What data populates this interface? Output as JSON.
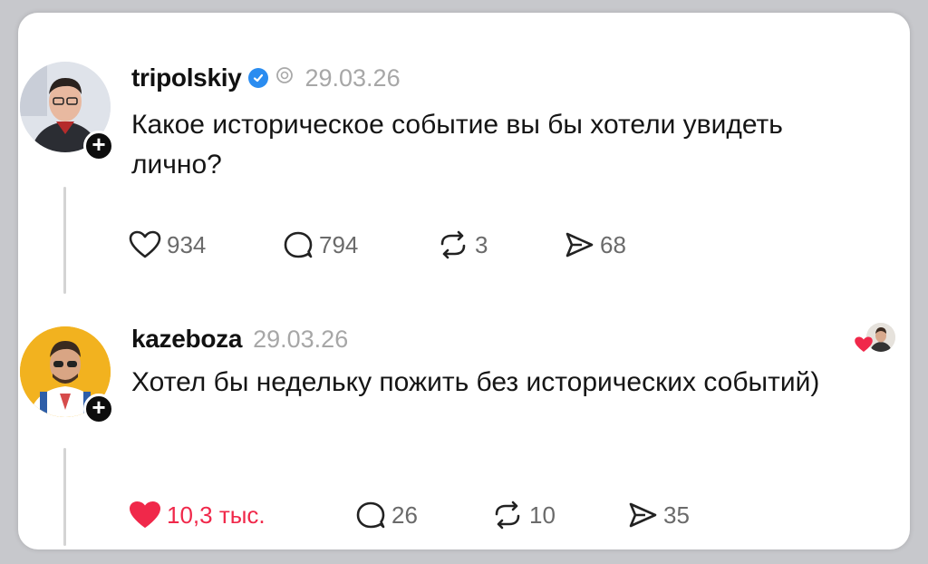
{
  "posts": [
    {
      "username": "tripolskiy",
      "date": "29.03.26",
      "text": "Какое историческое событие вы бы хотели увидеть лично?",
      "likes": "934",
      "replies": "794",
      "reposts": "3",
      "shares": "68",
      "verified": true
    },
    {
      "username": "kazeboza",
      "date": "29.03.26",
      "text": "Хотел бы недельку пожить без исторических событий)",
      "likes": "10,3 тыс.",
      "replies": "26",
      "reposts": "10",
      "shares": "35",
      "liked": true
    }
  ],
  "colors": {
    "like_active": "#f0284a",
    "verified": "#2a8cf0",
    "muted": "#a7a7a7"
  },
  "icons": {
    "follow": "+",
    "like": "heart-icon",
    "reply": "comment-icon",
    "repost": "repost-icon",
    "share": "send-icon",
    "threads": "threads-icon"
  }
}
